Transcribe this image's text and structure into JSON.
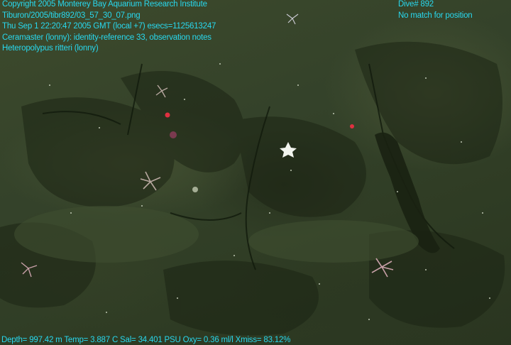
{
  "overlay": {
    "top_left": [
      "Copyright 2005 Monterey Bay Aquarium Research Institute",
      "Tiburon/2005/tibr892/03_57_30_07.png",
      "Thu Sep  1 22:20:47 2005 GMT (local +7)  esecs=1125613247",
      "Ceramaster (lonny): identity-reference 33, observation notes",
      "Heteropolypus ritteri (lonny)"
    ],
    "top_right": [
      "Dive# 892",
      "No match for position"
    ],
    "bottom": "Depth= 997.42 m  Temp= 3.887 C  Sal= 34.401 PSU  Oxy= 0.36 ml/l  Xmiss= 83.12%"
  },
  "colors": {
    "overlay_text": "#28d8ee",
    "seafloor": "#34422a"
  }
}
